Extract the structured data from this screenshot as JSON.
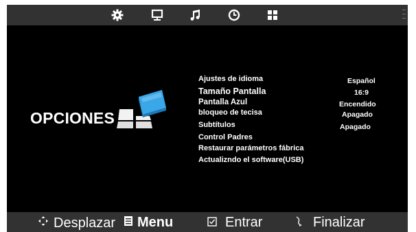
{
  "top_menu": {
    "icons": [
      {
        "name": "settings-icon",
        "selected": true
      },
      {
        "name": "picture-icon",
        "selected": false
      },
      {
        "name": "sound-icon",
        "selected": false
      },
      {
        "name": "time-icon",
        "selected": false
      },
      {
        "name": "options-grid-icon",
        "selected": false
      }
    ]
  },
  "panel": {
    "title": "OPCIONES"
  },
  "menu": {
    "items": [
      "Ajustes de idioma",
      "Tamaño Pantalla",
      "Pantalla Azul",
      "bloqueo de tecisa",
      "Subtítulos",
      "Control Padres",
      "Restaurar parámetros fábrica",
      "Actualizndo el software(USB)"
    ],
    "values": [
      "Español",
      "16:9",
      "Encendido",
      "Apagado",
      "Apagado"
    ]
  },
  "footer": {
    "move_label": "Desplazar",
    "menu_label": "Menu",
    "enter_label": "Entrar",
    "exit_label": "Finalizar"
  },
  "colors": {
    "bar": "#323232",
    "background": "#000000",
    "text": "#ffffff",
    "logo_blue": "#3aa7e8"
  }
}
